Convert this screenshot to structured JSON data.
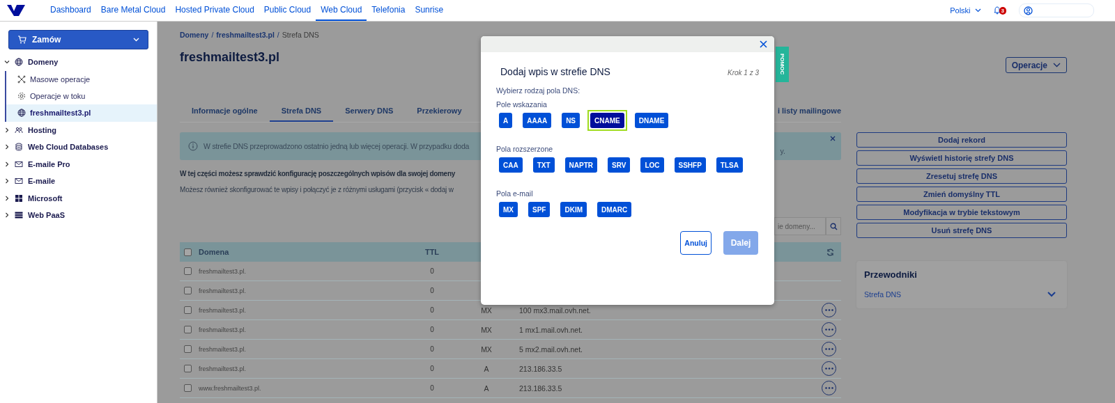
{
  "nav": {
    "items": [
      {
        "label": "Dashboard",
        "selected": false
      },
      {
        "label": "Bare Metal Cloud",
        "selected": false
      },
      {
        "label": "Hosted Private Cloud",
        "selected": false
      },
      {
        "label": "Public Cloud",
        "selected": false
      },
      {
        "label": "Web Cloud",
        "selected": true
      },
      {
        "label": "Telefonia",
        "selected": false
      },
      {
        "label": "Sunrise",
        "selected": false
      }
    ],
    "language": "Polski",
    "notifications": "3"
  },
  "sidebar": {
    "order_button": "Zamów",
    "items": [
      {
        "label": "Domeny",
        "expanded": true,
        "selected": false,
        "children": [
          {
            "label": "Masowe operacje",
            "selected": false
          },
          {
            "label": "Operacje w toku",
            "selected": false
          },
          {
            "label": "freshmailtest3.pl",
            "selected": true
          }
        ]
      },
      {
        "label": "Hosting",
        "expanded": false,
        "selected": false
      },
      {
        "label": "Web Cloud Databases",
        "expanded": false,
        "selected": false
      },
      {
        "label": "E-maile Pro",
        "expanded": false,
        "selected": false
      },
      {
        "label": "E-maile",
        "expanded": false,
        "selected": false
      },
      {
        "label": "Microsoft",
        "expanded": false,
        "selected": false
      },
      {
        "label": "Web PaaS",
        "expanded": false,
        "selected": false
      }
    ]
  },
  "breadcrumb": {
    "separator": "/",
    "items": [
      {
        "label": "Domeny",
        "link": true
      },
      {
        "label": "freshmailtest3.pl",
        "link": true
      },
      {
        "label": "Strefa DNS",
        "link": false
      }
    ]
  },
  "page_title": "freshmailtest3.pl",
  "operations_button": "Operacje",
  "tabs": [
    {
      "label": "Informacje ogólne",
      "selected": false
    },
    {
      "label": "Strefa DNS",
      "selected": true
    },
    {
      "label": "Serwery DNS",
      "selected": false
    },
    {
      "label": "Przekierowy",
      "selected": false
    },
    {
      "label": "i listy mailingowe",
      "selected": false
    }
  ],
  "notice": {
    "text_start": "W strefie DNS przeprowadzono ostatnio jedną lub więcej operacji. W przypadku doda",
    "text_end": "y."
  },
  "intro": "W tej części możesz sprawdzić konfigurację poszczególnych wpisów dla swojej domeny",
  "description": "Możesz również skonfigurować te wpisy i połączyć je z różnymi usługami (przycisk « dodaj w",
  "search": {
    "placeholder": "ie domeny..."
  },
  "table": {
    "all_checked": false,
    "columns": [
      "Domena",
      "TTL"
    ],
    "rows": [
      {
        "checked": false,
        "domain": "freshmailtest3.pl.",
        "ttl": "0",
        "actions": false
      },
      {
        "checked": false,
        "domain": "freshmailtest3.pl.",
        "ttl": "0",
        "actions": false
      },
      {
        "checked": false,
        "domain": "freshmailtest3.pl.",
        "ttl": "0",
        "type": "MX",
        "target": "100 mx3.mail.ovh.net.",
        "actions": true
      },
      {
        "checked": false,
        "domain": "freshmailtest3.pl.",
        "ttl": "0",
        "type": "MX",
        "target": "1 mx1.mail.ovh.net.",
        "actions": true
      },
      {
        "checked": false,
        "domain": "freshmailtest3.pl.",
        "ttl": "0",
        "type": "MX",
        "target": "5 mx2.mail.ovh.net.",
        "actions": true
      },
      {
        "checked": false,
        "domain": "freshmailtest3.pl.",
        "ttl": "0",
        "type": "A",
        "target": "213.186.33.5",
        "actions": true
      },
      {
        "checked": false,
        "domain": "www.freshmailtest3.pl.",
        "ttl": "0",
        "type": "A",
        "target": "213.186.33.5",
        "actions": true
      }
    ]
  },
  "actions": [
    "Dodaj rekord",
    "Wyświetl historię strefy DNS",
    "Zresetuj strefę DNS",
    "Zmień domyślny TTL",
    "Modyfikacja w trybie tekstowym",
    "Usuń strefę DNS"
  ],
  "guides": {
    "title": "Przewodniki",
    "items": [
      {
        "label": "Strefa DNS",
        "expanded": false
      }
    ]
  },
  "help_tab": "POMOC",
  "modal": {
    "title": "Dodaj wpis w strefie DNS",
    "step": "Krok 1 z 3",
    "prompt": "Wybierz rodzaj pola DNS:",
    "groups": [
      {
        "label": "Pole wskazania",
        "types": [
          {
            "label": "A",
            "selected": false
          },
          {
            "label": "AAAA",
            "selected": false
          },
          {
            "label": "NS",
            "selected": false
          },
          {
            "label": "CNAME",
            "selected": true
          },
          {
            "label": "DNAME",
            "selected": false
          }
        ]
      },
      {
        "label": "Pola rozszerzone",
        "types": [
          {
            "label": "CAA",
            "selected": false
          },
          {
            "label": "TXT",
            "selected": false
          },
          {
            "label": "NAPTR",
            "selected": false
          },
          {
            "label": "SRV",
            "selected": false
          },
          {
            "label": "LOC",
            "selected": false
          },
          {
            "label": "SSHFP",
            "selected": false
          },
          {
            "label": "TLSA",
            "selected": false
          }
        ]
      },
      {
        "label": "Pola e-mail",
        "types": [
          {
            "label": "MX",
            "selected": false
          },
          {
            "label": "SPF",
            "selected": false
          },
          {
            "label": "DKIM",
            "selected": false
          },
          {
            "label": "DMARC",
            "selected": false
          }
        ]
      }
    ],
    "cancel": "Anuluj",
    "next": {
      "label": "Dalej",
      "disabled": true
    }
  }
}
